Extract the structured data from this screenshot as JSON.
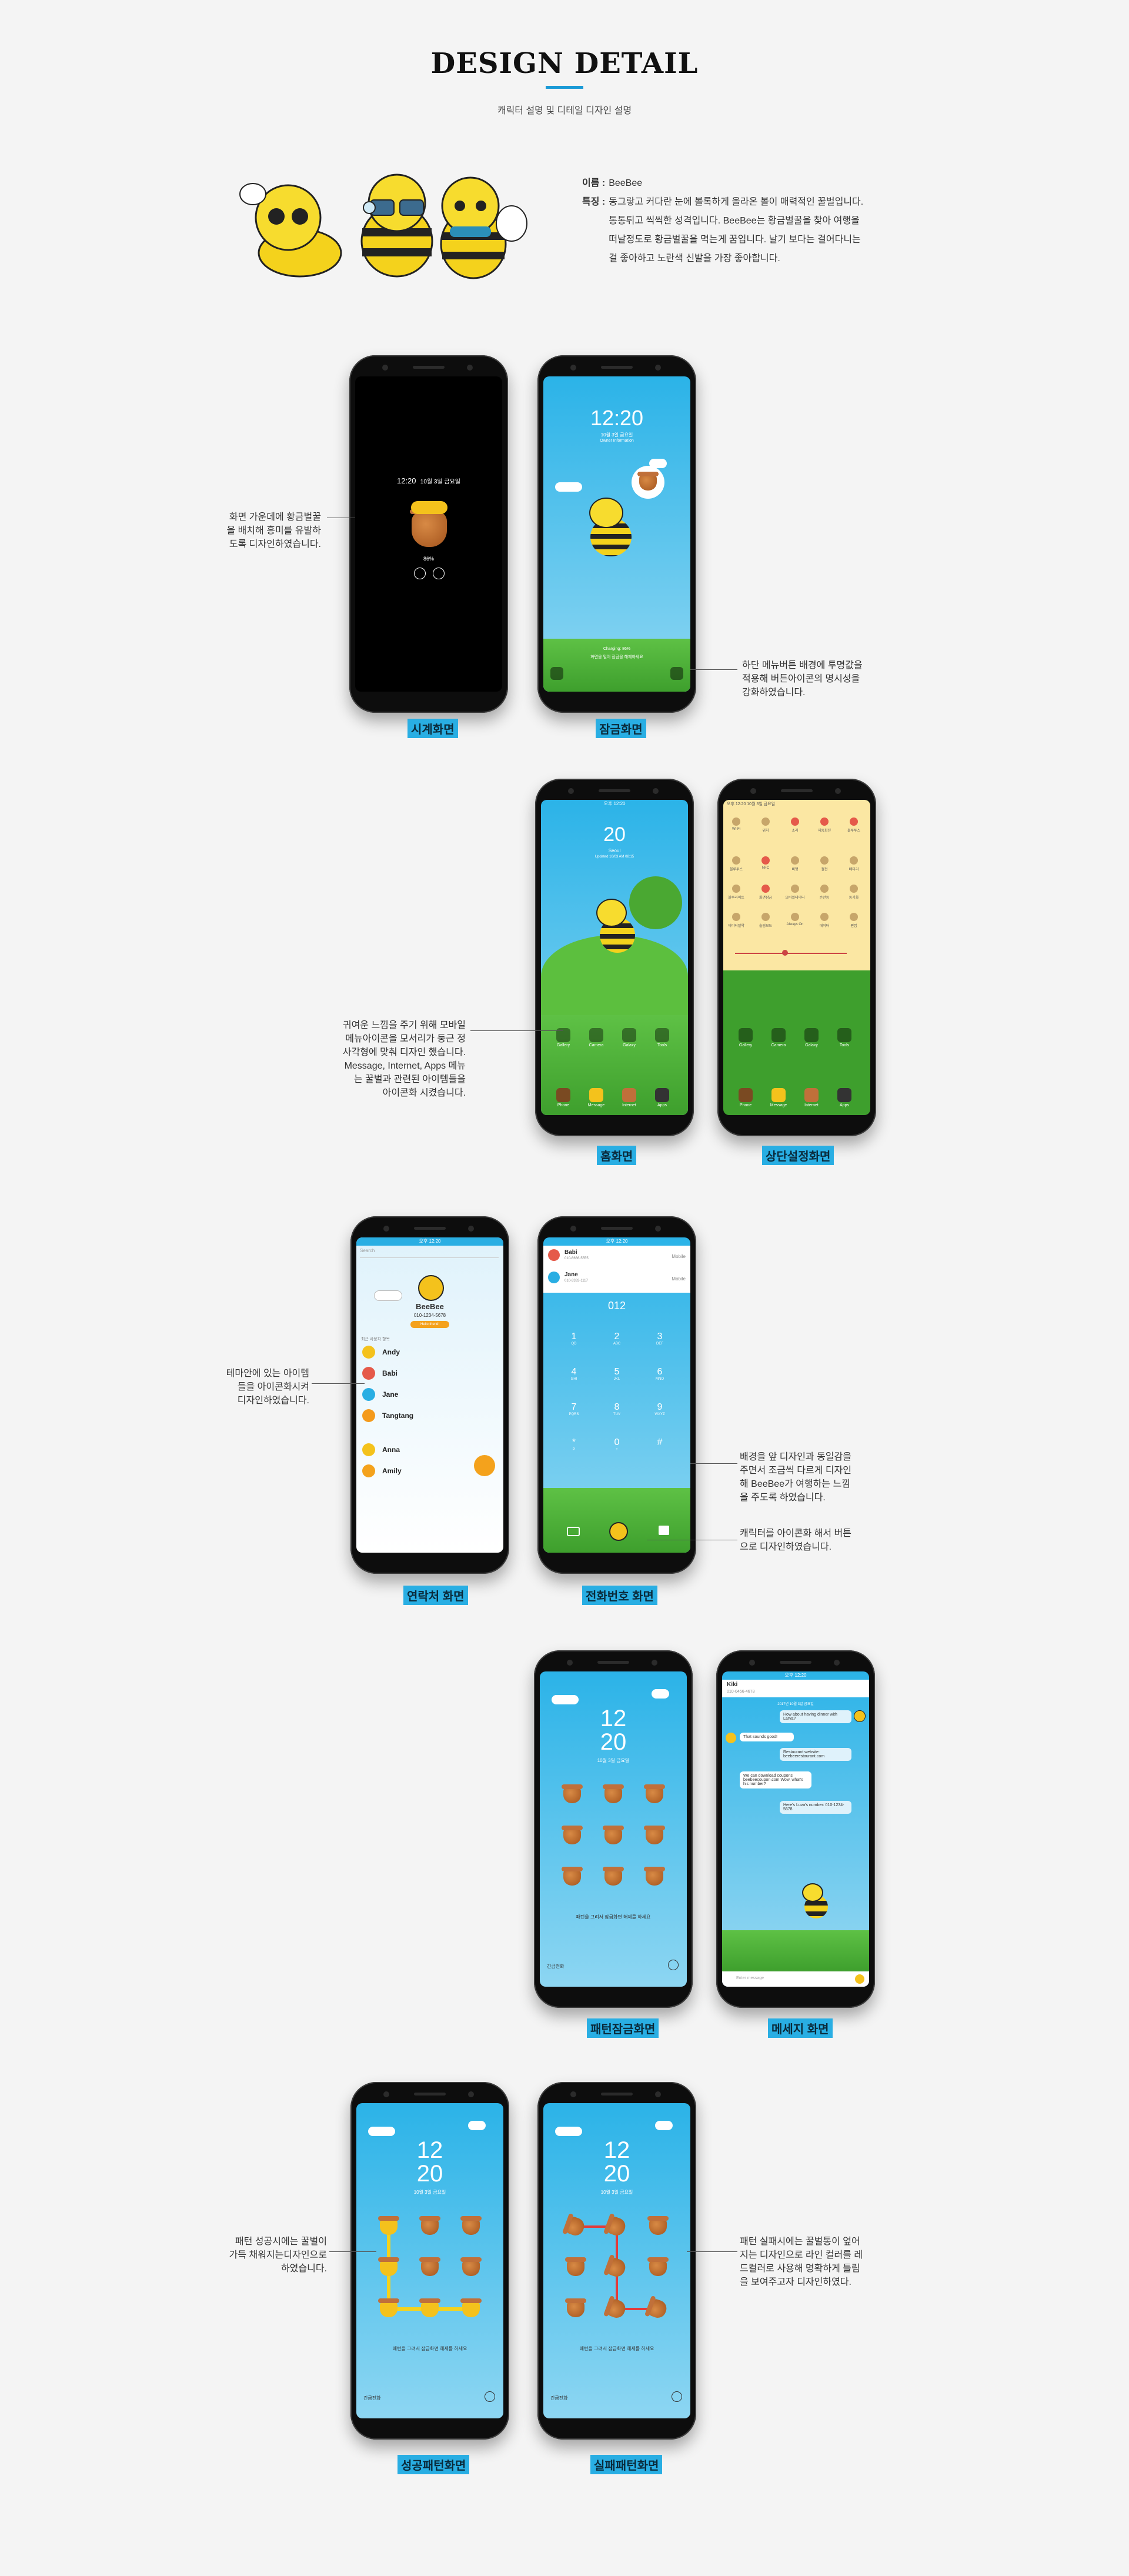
{
  "header": {
    "title": "DESIGN DETAIL",
    "subtitle": "캐릭터 설명 및 디테일 디자인 설명"
  },
  "character": {
    "name_label": "이름 :",
    "name_value": "BeeBee",
    "feature_label": "특징 :",
    "feature_lines": [
      "동그랗고 커다란 눈에 볼록하게 올라온 볼이 매력적인 꿀벌입니다.",
      "통통튀고 씩씩한 성격입니다. BeeBee는 황금벌꿀을 찾아 여행을",
      "떠날정도로 황금벌꿀을 먹는게 꿈입니다. 날기 보다는 걸어다니는",
      "걸 좋아하고 노란색 신발을 가장 좋아합니다."
    ]
  },
  "sections": {
    "clock": {
      "label": "시계화면",
      "time": "12:20",
      "date": "10월 3일 금요일",
      "battery": "86%",
      "caption": [
        "화면 가운데에 황금벌꿀",
        "을 배치해 흥미를 유발하",
        "도록 디자인하였습니다."
      ]
    },
    "lock": {
      "label": "잠금화면",
      "time": "12:20",
      "date": "10월 3일 금요일",
      "owner": "Owner Information",
      "charging": "Charging: 86%",
      "swipe": "화면을 밀어 잠금을 해제하세요",
      "caption": [
        "하단 메뉴버튼 배경에 투명값을",
        "적용해 버튼아이콘의 명시성을",
        "강화하였습니다."
      ]
    },
    "home": {
      "label": "홈화면",
      "status": "오후 12:20",
      "temp": "20",
      "city": "Seoul",
      "updated": "Updated 10/03 AM 08:15",
      "icons": [
        "Gallery",
        "Camera",
        "Galaxy",
        "Tools"
      ],
      "dock": [
        "Phone",
        "Message",
        "Internet",
        "Apps"
      ],
      "caption": [
        "귀여운 느낌을 주기 위해 모바일",
        "메뉴아이콘을 모서리가 둥근 정",
        "사각형에 맞춰 디자인 했습니다.",
        "Message, Internet, Apps 메뉴",
        "는 꿀벌과 관련된 아이템들을",
        "아이콘화 시켰습니다."
      ]
    },
    "quick": {
      "label": "상단설정화면",
      "status": "오후 12:20  10월 3일 금요일",
      "row1": [
        "Wi-Fi",
        "위치",
        "소리",
        "자동회전",
        "블루투스"
      ],
      "row2": [
        "블루투스",
        "NFC",
        "비행",
        "절전",
        "배터리"
      ],
      "row3": [
        "블루라이트",
        "화면잠금",
        "모바일데이터",
        "손전등",
        "동기화"
      ],
      "row4": [
        "데이터절약",
        "슬림모드",
        "Always On",
        "데이터",
        "편집"
      ],
      "icons": [
        "Gallery",
        "Camera",
        "Galaxy",
        "Tools"
      ],
      "dock": [
        "Phone",
        "Message",
        "Internet",
        "Apps"
      ]
    },
    "contacts": {
      "label": "연락처 화면",
      "status": "오후 12:20",
      "search": "Search",
      "name": "BeeBee",
      "phone": "010-1234-5678",
      "badge": "Hello friend!",
      "group": "최근 사용자 항목",
      "list": [
        "Andy",
        "Babi",
        "Jane",
        "Tangtang",
        "Anna",
        "Amily"
      ],
      "caption": [
        "테마안에 있는 아이템",
        "들을 아이콘화시켜",
        "디자인하였습니다."
      ]
    },
    "dialer": {
      "label": "전화번호 화면",
      "status": "오후 12:20",
      "recents": [
        {
          "name": "Babi",
          "number": "010-6666-5555",
          "type": "Mobile"
        },
        {
          "name": "Jane",
          "number": "010-3333-1117",
          "type": "Mobile"
        }
      ],
      "input": "012",
      "keys": [
        {
          "d": "1",
          "s": "QD"
        },
        {
          "d": "2",
          "s": "ABC"
        },
        {
          "d": "3",
          "s": "DEF"
        },
        {
          "d": "4",
          "s": "GHI"
        },
        {
          "d": "5",
          "s": "JKL"
        },
        {
          "d": "6",
          "s": "MNO"
        },
        {
          "d": "7",
          "s": "PQRS"
        },
        {
          "d": "8",
          "s": "TUV"
        },
        {
          "d": "9",
          "s": "WXYZ"
        },
        {
          "d": "*",
          "s": "P"
        },
        {
          "d": "0",
          "s": "+"
        },
        {
          "d": "#",
          "s": ""
        }
      ],
      "caption1": [
        "배경을 앞 디자인과 동일감을",
        "주면서 조금씩 다르게 디자인",
        "해 BeeBee가 여행하는 느낌",
        "을 주도록 하였습니다."
      ],
      "caption2": [
        "캐릭터를 아이콘화 해서 버튼",
        "으로 디자인하였습니다."
      ]
    },
    "pattern_lock": {
      "label": "패턴잠금화면",
      "hour": "12",
      "minute": "20",
      "date": "10월 3일 금요일",
      "hint": "패턴을 그려서 잠금화면 해제를 하세요",
      "emergency": "긴급전화"
    },
    "message": {
      "label": "메세지 화면",
      "status": "오후 12:20",
      "contact": "Kiki",
      "number": "010-0456-4678",
      "date": "2017년 10월 3일 금요일",
      "bubbles": [
        "How about having dinner with Larva?",
        "That sounds good!",
        "Restaurant website: beebeerestaurant.com",
        "We can download coupons beebeecoupon.com Wow, what's his number?",
        "Here's Luva's number: 010-1234-5678"
      ],
      "placeholder": "Enter message"
    },
    "success": {
      "label": "성공패턴화면",
      "hour": "12",
      "minute": "20",
      "date": "10월 3일 금요일",
      "hint": "패턴을 그려서 잠금화면 해제를 하세요",
      "emergency": "긴급전화",
      "caption": [
        "패턴 성공시에는 꿀벌이",
        "가득 채워지는디자인으로",
        "하였습니다."
      ]
    },
    "fail": {
      "label": "실패패턴화면",
      "hour": "12",
      "minute": "20",
      "date": "10월 3일 금요일",
      "hint": "패턴을 그려서 잠금화면 해제를 하세요",
      "emergency": "긴급전화",
      "caption": [
        "패턴 실패시에는 꿀벌통이 엎어",
        "지는 디자인으로 라인 컬러를 레",
        "드컬러로 사용해 명확하게 틀림",
        "을 보여주고자 디자인하였다."
      ]
    }
  },
  "colors": {
    "accent": "#29aee3",
    "sky": "#2bb3e8",
    "grass": "#4fb83a",
    "honey": "#f4d21c",
    "fail_line": "#e23b3b"
  }
}
